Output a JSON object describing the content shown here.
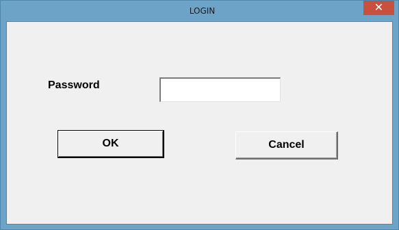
{
  "window": {
    "title": "LOGIN",
    "close_glyph": "✕",
    "close_icon": "close-icon",
    "colors": {
      "title_bar": "#6ea3c8",
      "close_button": "#c7503f",
      "client_area": "#f0f0f0"
    }
  },
  "form": {
    "password_label": "Password",
    "password_value": "",
    "ok_label": "OK",
    "cancel_label": "Cancel"
  }
}
